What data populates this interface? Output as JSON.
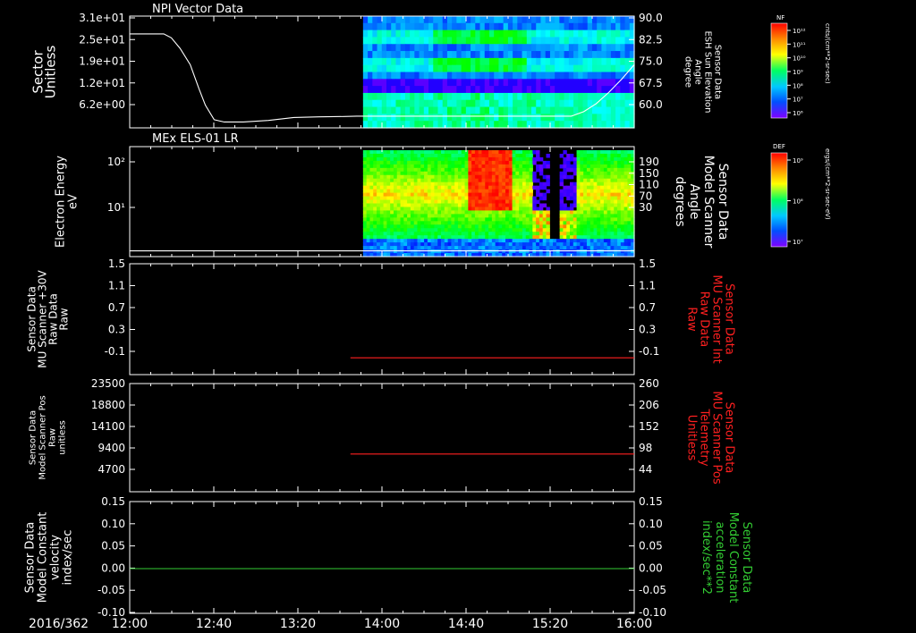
{
  "colors": {
    "background": "#000000",
    "axis": "#ffffff",
    "red_trace": "#ff2020",
    "green_trace": "#33cc33",
    "white_trace": "#ffffff"
  },
  "time_axis": {
    "prefix": "2016/362",
    "ticks": [
      "12:00",
      "12:40",
      "13:20",
      "14:00",
      "14:40",
      "15:20",
      "16:00"
    ],
    "start_hours": 12.0,
    "end_hours": 16.0
  },
  "panels": [
    {
      "id": "npi",
      "title": "NPI Vector Data",
      "left_label": [
        "Sector",
        "Unitless"
      ],
      "left_ticks": [
        "3.1e+01",
        "2.5e+01",
        "1.9e+01",
        "1.2e+01",
        "6.2e+00"
      ],
      "right_label": [
        "Sensor Data",
        "ESH Sun Elevation",
        "Angle",
        "degree"
      ],
      "right_ticks": [
        "90.0",
        "82.5",
        "75.0",
        "67.5",
        "60.0"
      ],
      "colorbar": {
        "tag": "NF",
        "ticks": [
          "10¹²",
          "10¹¹",
          "10¹⁰",
          "10⁹",
          "10⁸",
          "10⁷",
          "10⁶"
        ],
        "unit": "cnts/(cm**2-sr-sec)"
      }
    },
    {
      "id": "els",
      "title": "MEx ELS-01 LR",
      "left_label": [
        "Electron Energy",
        "eV"
      ],
      "left_ticks": [
        "10²",
        "10¹"
      ],
      "right_label": [
        "Sensor Data",
        "Model Scanner",
        "Angle",
        "degrees"
      ],
      "right_ticks": [
        "190",
        "150",
        "110",
        "70",
        "30"
      ],
      "colorbar": {
        "tag": "DEF",
        "ticks": [
          "10⁹",
          "10⁸",
          "10⁷"
        ],
        "unit": "ergs/(cm**2-sr-sec-eV)"
      }
    },
    {
      "id": "mu_raw",
      "left_label": [
        "Sensor Data",
        "MU Scanner +30V",
        "Raw Data",
        "Raw"
      ],
      "left_ticks": [
        "1.5",
        "1.1",
        "0.7",
        "0.3",
        "-0.1"
      ],
      "right_label": [
        "Sensor Data",
        "MU Scanner Int",
        "Raw Data",
        "Raw"
      ],
      "right_ticks": [
        "1.5",
        "1.1",
        "0.7",
        "0.3",
        "-0.1"
      ]
    },
    {
      "id": "scanner_pos",
      "left_label": [
        "Sensor Data",
        "Model Scanner Pos",
        "Raw",
        "unitless"
      ],
      "left_ticks": [
        "23500",
        "18800",
        "14100",
        "9400",
        "4700"
      ],
      "right_label": [
        "Sensor Data",
        "MU Scanner Pos",
        "Telemetry",
        "Unitless"
      ],
      "right_ticks": [
        "260",
        "206",
        "152",
        "98",
        "44"
      ]
    },
    {
      "id": "velocity",
      "left_label": [
        "Sensor Data",
        "Model Constant",
        "velocity",
        "index/sec"
      ],
      "left_ticks": [
        "0.15",
        "0.10",
        "0.05",
        "0.00",
        "-0.05",
        "-0.10"
      ],
      "right_label": [
        "Sensor Data",
        "Model Constant",
        "acceleration",
        "index/sec**2"
      ],
      "right_ticks": [
        "0.15",
        "0.10",
        "0.05",
        "0.00",
        "-0.05",
        "-0.10"
      ]
    }
  ],
  "chart_data": [
    {
      "type": "heatmap",
      "panel": "npi",
      "title": "NPI Vector Data",
      "data_coverage_start_hours": 13.85,
      "overlay_line": {
        "axis": "right",
        "ylim": [
          55.5,
          90.0
        ],
        "x_hours": [
          12.0,
          12.27,
          12.33,
          12.4,
          12.48,
          12.55,
          12.6,
          12.67,
          12.75,
          12.9,
          13.1,
          13.3,
          13.5,
          13.7,
          13.8,
          14.0,
          14.5,
          15.0,
          15.3,
          15.5,
          15.6,
          15.7,
          15.8,
          15.9,
          16.0
        ],
        "y": [
          84.5,
          84.5,
          83.3,
          80.0,
          75.0,
          67.5,
          62.5,
          58.0,
          57.3,
          57.3,
          57.8,
          58.7,
          58.9,
          59.0,
          59.1,
          59.1,
          59.1,
          59.1,
          59.1,
          59.1,
          60.5,
          63.0,
          66.5,
          70.5,
          75.0
        ]
      }
    },
    {
      "type": "heatmap",
      "panel": "els",
      "title": "MEx ELS-01 LR",
      "data_coverage_start_hours": 13.85,
      "overlay_line": {
        "axis": "right",
        "ylim": [
          0,
          190
        ],
        "x_hours": [
          12.0,
          16.0
        ],
        "y": [
          10,
          10
        ]
      }
    },
    {
      "type": "line",
      "panel": "mu_raw",
      "series": [
        {
          "x_hours": [
            13.75,
            16.0
          ],
          "y": [
            -0.07,
            -0.07
          ]
        }
      ],
      "ylim": [
        -0.35,
        1.5
      ]
    },
    {
      "type": "line",
      "panel": "scanner_pos",
      "series": [
        {
          "x_hours": [
            13.75,
            16.0
          ],
          "y": [
            8200,
            8200
          ]
        }
      ],
      "ylim": [
        0,
        23500
      ]
    },
    {
      "type": "line",
      "panel": "velocity",
      "series": [
        {
          "x_hours": [
            12.0,
            16.0
          ],
          "y": [
            0.0,
            0.0
          ]
        }
      ],
      "ylim": [
        -0.1,
        0.15
      ]
    }
  ]
}
